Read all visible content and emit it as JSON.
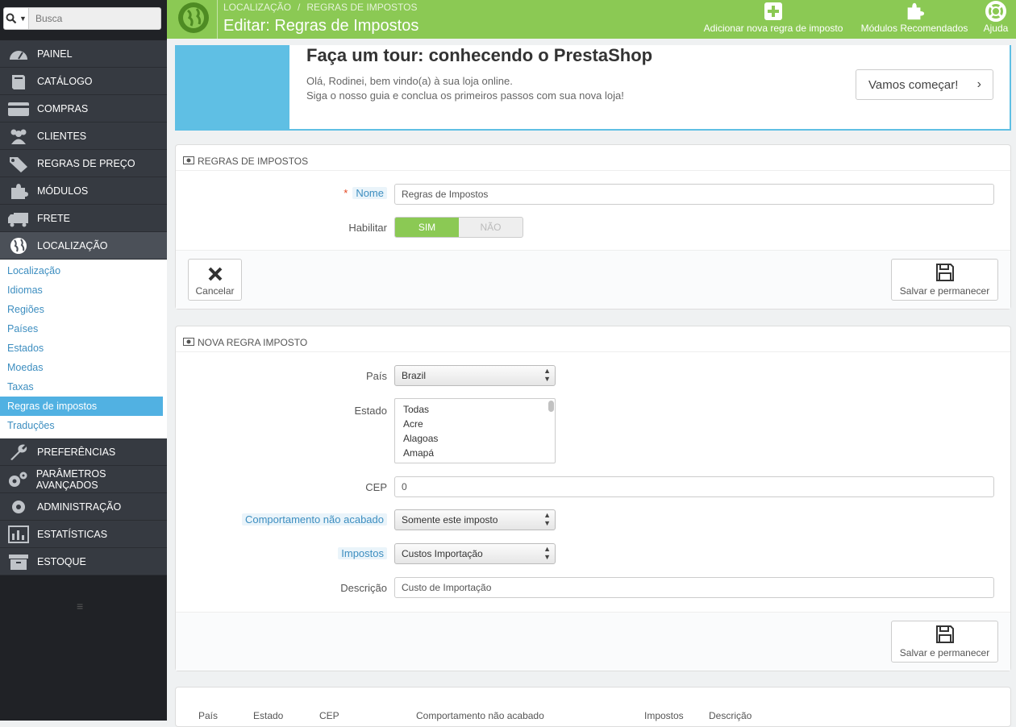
{
  "search": {
    "placeholder": "Busca"
  },
  "sidebar": {
    "items_top": [
      {
        "label": "PAINEL",
        "icon": "dashboard-icon"
      },
      {
        "label": "CATÁLOGO",
        "icon": "book-icon"
      },
      {
        "label": "COMPRAS",
        "icon": "credit-card-icon"
      },
      {
        "label": "CLIENTES",
        "icon": "users-icon"
      },
      {
        "label": "REGRAS DE PREÇO",
        "icon": "tags-icon"
      },
      {
        "label": "MÓDULOS",
        "icon": "puzzle-icon"
      },
      {
        "label": "FRETE",
        "icon": "truck-icon"
      },
      {
        "label": "LOCALIZAÇÃO",
        "icon": "globe-icon"
      }
    ],
    "submenu": [
      "Localização",
      "Idiomas",
      "Regiões",
      "Países",
      "Estados",
      "Moedas",
      "Taxas",
      "Regras de impostos",
      "Traduções"
    ],
    "items_bottom": [
      {
        "label": "PREFERÊNCIAS",
        "icon": "wrench-icon"
      },
      {
        "label": "PARÂMETROS AVANÇADOS",
        "icon": "gears-icon"
      },
      {
        "label": "ADMINISTRAÇÃO",
        "icon": "gear-icon"
      },
      {
        "label": "ESTATÍSTICAS",
        "icon": "bar-chart-icon"
      },
      {
        "label": "ESTOQUE",
        "icon": "archive-icon"
      }
    ]
  },
  "header": {
    "breadcrumb_1": "LOCALIZAÇÃO",
    "breadcrumb_sep": "/",
    "breadcrumb_2": "REGRAS DE IMPOSTOS",
    "title": "Editar: Regras de Impostos",
    "add_label": "Adicionar nova regra de imposto",
    "modules_label": "Módulos Recomendados",
    "help_label": "Ajuda",
    "accent": "#8bc954"
  },
  "tour": {
    "title": "Faça um tour: conhecendo o PrestaShop",
    "line1": "Olá, Rodinei, bem vindo(a) à sua loja online.",
    "line2": "Siga o nosso guia e conclua os primeiros passos com sua nova loja!",
    "button": "Vamos começar!"
  },
  "rules_panel": {
    "heading": "REGRAS DE IMPOSTOS",
    "name_label": "Nome",
    "name_value": "Regras de Impostos",
    "enable_label": "Habilitar",
    "yes": "SIM",
    "no": "NÃO",
    "cancel": "Cancelar",
    "save": "Salvar e permanecer"
  },
  "new_rule_panel": {
    "heading": "NOVA REGRA IMPOSTO",
    "country_label": "País",
    "country_value": "Brazil",
    "state_label": "Estado",
    "states": [
      "Todas",
      "Acre",
      "Alagoas",
      "Amapá"
    ],
    "zip_label": "CEP",
    "zip_value": "0",
    "behavior_label": "Comportamento não acabado",
    "behavior_value": "Somente este imposto",
    "tax_label": "Impostos",
    "tax_value": "Custos Importação",
    "desc_label": "Descrição",
    "desc_value": "Custo de Importação",
    "save": "Salvar e permanecer"
  },
  "table": {
    "columns": [
      "País",
      "Estado",
      "CEP",
      "Comportamento não acabado",
      "Impostos",
      "Descrição"
    ]
  }
}
